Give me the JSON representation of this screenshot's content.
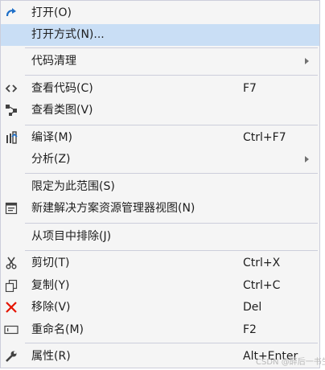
{
  "menu": {
    "items": [
      {
        "label": "打开(O)",
        "icon": "redo-arrow-icon"
      },
      {
        "label": "打开方式(N)...",
        "highlighted": true
      },
      {
        "label": "代码清理",
        "has_submenu": true
      },
      {
        "label": "查看代码(C)",
        "shortcut": "F7",
        "icon": "code-icon"
      },
      {
        "label": "查看类图(V)",
        "icon": "class-diagram-icon"
      },
      {
        "label": "编译(M)",
        "shortcut": "Ctrl+F7",
        "icon": "build-icon"
      },
      {
        "label": "分析(Z)",
        "has_submenu": true
      },
      {
        "label": "限定为此范围(S)"
      },
      {
        "label": "新建解决方案资源管理器视图(N)",
        "icon": "new-view-icon"
      },
      {
        "label": "从项目中排除(J)"
      },
      {
        "label": "剪切(T)",
        "shortcut": "Ctrl+X",
        "icon": "scissors-icon"
      },
      {
        "label": "复制(Y)",
        "shortcut": "Ctrl+C",
        "icon": "copy-icon"
      },
      {
        "label": "移除(V)",
        "shortcut": "Del",
        "icon": "remove-x-icon"
      },
      {
        "label": "重命名(M)",
        "shortcut": "F2",
        "icon": "rename-icon"
      },
      {
        "label": "属性(R)",
        "shortcut": "Alt+Enter",
        "icon": "wrench-icon"
      }
    ]
  },
  "watermark": "CSDN @醉后一书生",
  "colors": {
    "highlight": "#c9def5",
    "icon_blue": "#1e6fc8",
    "icon_dark": "#424242",
    "remove_red": "#e51400"
  }
}
